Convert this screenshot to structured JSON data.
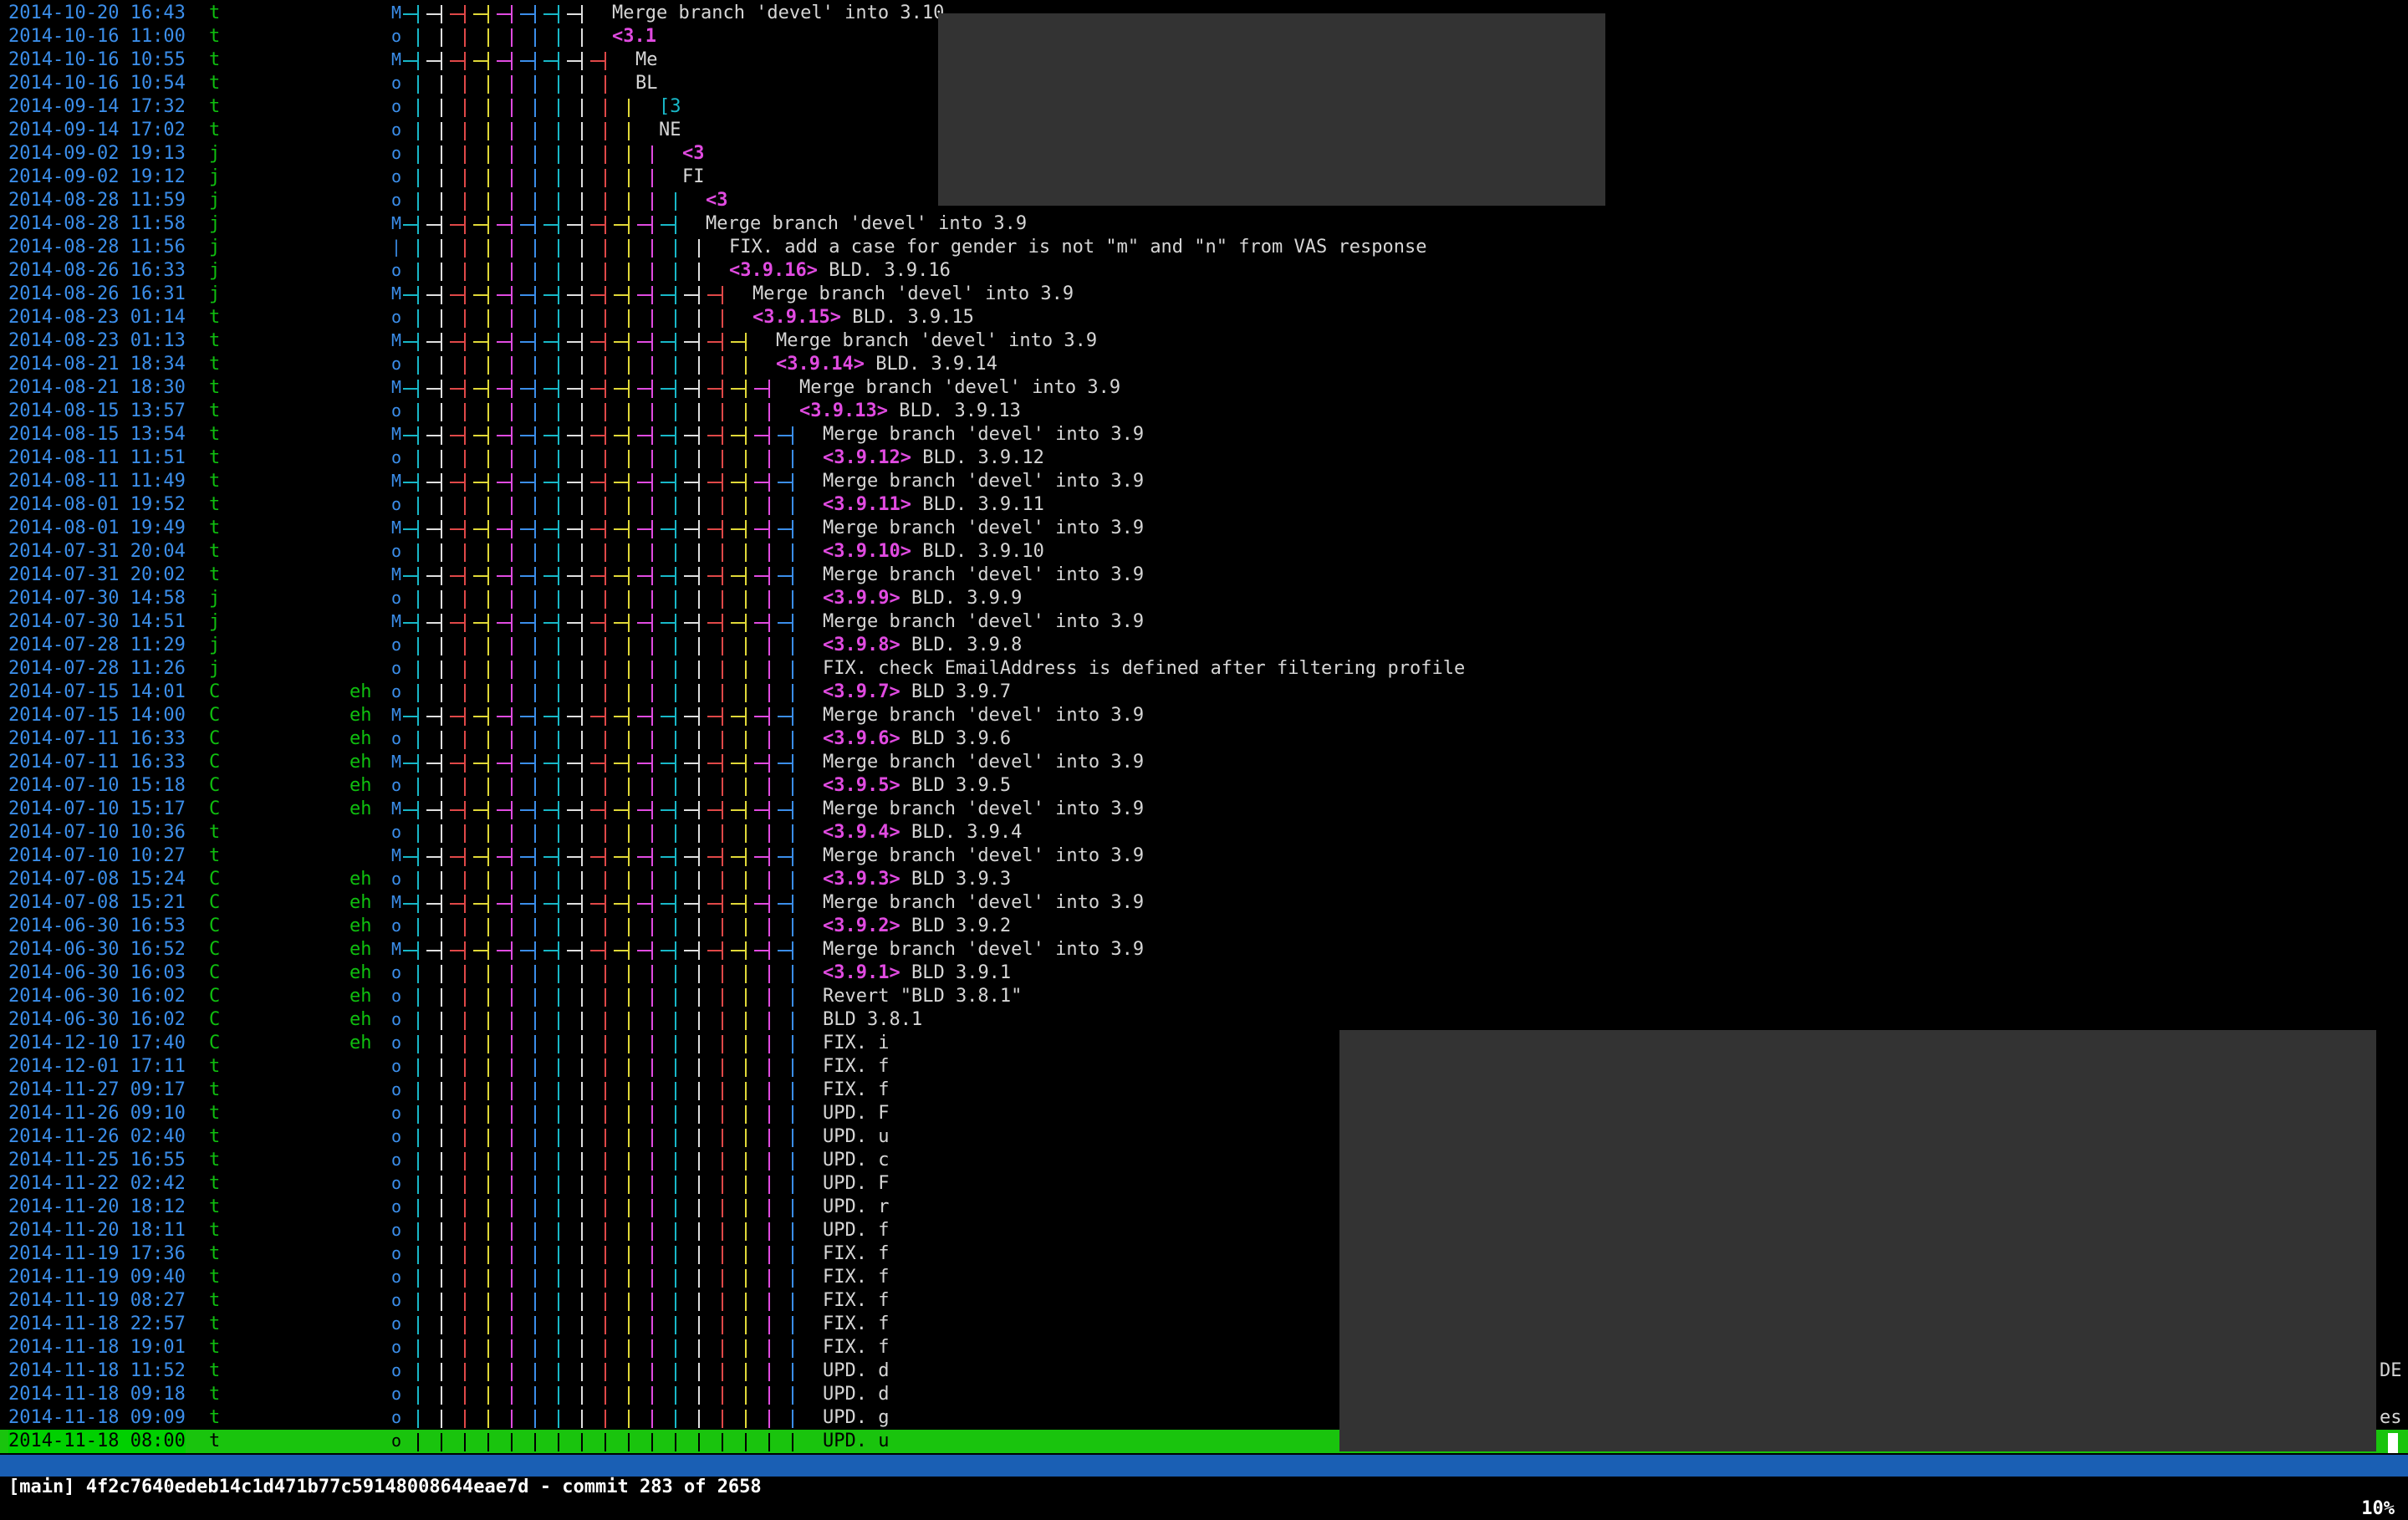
{
  "colors": {
    "date": "#3b8eea",
    "selection": "#19c40d",
    "status_bar": "#1a5fb4",
    "tag": "#e14be1",
    "occluder": "#333333"
  },
  "commits": [
    {
      "date": "2014-10-20 16:43",
      "author": "t",
      "author_tail": "",
      "graph": "M",
      "msg": "Merge branch 'devel' into 3.10",
      "tag": ""
    },
    {
      "date": "2014-10-16 11:00",
      "author": "t",
      "author_tail": "",
      "graph": "o",
      "msg": "",
      "tag": "<3.1"
    },
    {
      "date": "2014-10-16 10:55",
      "author": "t",
      "author_tail": "",
      "graph": "M",
      "msg": "Me",
      "tag": ""
    },
    {
      "date": "2014-10-16 10:54",
      "author": "t",
      "author_tail": "",
      "graph": "o",
      "msg": "BL",
      "tag": ""
    },
    {
      "date": "2014-09-14 17:32",
      "author": "t",
      "author_tail": "",
      "graph": "o",
      "msg": "",
      "tag": "[3"
    },
    {
      "date": "2014-09-14 17:02",
      "author": "t",
      "author_tail": "",
      "graph": "o",
      "msg": "NE",
      "tag": ""
    },
    {
      "date": "2014-09-02 19:13",
      "author": "j",
      "author_tail": "",
      "graph": "o",
      "msg": "",
      "tag": "<3"
    },
    {
      "date": "2014-09-02 19:12",
      "author": "j",
      "author_tail": "",
      "graph": "o",
      "msg": "FI",
      "tag": ""
    },
    {
      "date": "2014-08-28 11:59",
      "author": "j",
      "author_tail": "",
      "graph": "o",
      "msg": "",
      "tag": "<3"
    },
    {
      "date": "2014-08-28 11:58",
      "author": "j",
      "author_tail": "",
      "graph": "M",
      "msg": "Merge branch 'devel' into 3.9",
      "tag": ""
    },
    {
      "date": "2014-08-28 11:56",
      "author": "j",
      "author_tail": "",
      "graph": "|",
      "msg": "FIX. add a case for gender is not \"m\" and \"n\" from VAS response",
      "tag": ""
    },
    {
      "date": "2014-08-26 16:33",
      "author": "j",
      "author_tail": "",
      "graph": "o",
      "msg": "BLD. 3.9.16",
      "tag": "<3.9.16>"
    },
    {
      "date": "2014-08-26 16:31",
      "author": "j",
      "author_tail": "",
      "graph": "M",
      "msg": "Merge branch 'devel' into 3.9",
      "tag": ""
    },
    {
      "date": "2014-08-23 01:14",
      "author": "t",
      "author_tail": "",
      "graph": "o",
      "msg": "BLD. 3.9.15",
      "tag": "<3.9.15>"
    },
    {
      "date": "2014-08-23 01:13",
      "author": "t",
      "author_tail": "",
      "graph": "M",
      "msg": "Merge branch 'devel' into 3.9",
      "tag": ""
    },
    {
      "date": "2014-08-21 18:34",
      "author": "t",
      "author_tail": "",
      "graph": "o",
      "msg": "BLD. 3.9.14",
      "tag": "<3.9.14>"
    },
    {
      "date": "2014-08-21 18:30",
      "author": "t",
      "author_tail": "",
      "graph": "M",
      "msg": "Merge branch 'devel' into 3.9",
      "tag": ""
    },
    {
      "date": "2014-08-15 13:57",
      "author": "t",
      "author_tail": "",
      "graph": "o",
      "msg": "BLD. 3.9.13",
      "tag": "<3.9.13>"
    },
    {
      "date": "2014-08-15 13:54",
      "author": "t",
      "author_tail": "",
      "graph": "M",
      "msg": "Merge branch 'devel' into 3.9",
      "tag": ""
    },
    {
      "date": "2014-08-11 11:51",
      "author": "t",
      "author_tail": "",
      "graph": "o",
      "msg": "BLD. 3.9.12",
      "tag": "<3.9.12>"
    },
    {
      "date": "2014-08-11 11:49",
      "author": "t",
      "author_tail": "",
      "graph": "M",
      "msg": "Merge branch 'devel' into 3.9",
      "tag": ""
    },
    {
      "date": "2014-08-01 19:52",
      "author": "t",
      "author_tail": "",
      "graph": "o",
      "msg": "BLD. 3.9.11",
      "tag": "<3.9.11>"
    },
    {
      "date": "2014-08-01 19:49",
      "author": "t",
      "author_tail": "",
      "graph": "M",
      "msg": "Merge branch 'devel' into 3.9",
      "tag": ""
    },
    {
      "date": "2014-07-31 20:04",
      "author": "t",
      "author_tail": "",
      "graph": "o",
      "msg": "BLD. 3.9.10",
      "tag": "<3.9.10>"
    },
    {
      "date": "2014-07-31 20:02",
      "author": "t",
      "author_tail": "",
      "graph": "M",
      "msg": "Merge branch 'devel' into 3.9",
      "tag": ""
    },
    {
      "date": "2014-07-30 14:58",
      "author": "j",
      "author_tail": "",
      "graph": "o",
      "msg": "BLD. 3.9.9",
      "tag": "<3.9.9>"
    },
    {
      "date": "2014-07-30 14:51",
      "author": "j",
      "author_tail": "",
      "graph": "M",
      "msg": "Merge branch 'devel' into 3.9",
      "tag": ""
    },
    {
      "date": "2014-07-28 11:29",
      "author": "j",
      "author_tail": "",
      "graph": "o",
      "msg": "BLD. 3.9.8",
      "tag": "<3.9.8>"
    },
    {
      "date": "2014-07-28 11:26",
      "author": "j",
      "author_tail": "",
      "graph": "o",
      "msg": "FIX. check EmailAddress is defined after filtering profile",
      "tag": ""
    },
    {
      "date": "2014-07-15 14:01",
      "author": "C",
      "author_tail": "eh",
      "graph": "o",
      "msg": "BLD 3.9.7",
      "tag": "<3.9.7>"
    },
    {
      "date": "2014-07-15 14:00",
      "author": "C",
      "author_tail": "eh",
      "graph": "M",
      "msg": "Merge branch 'devel' into 3.9",
      "tag": ""
    },
    {
      "date": "2014-07-11 16:33",
      "author": "C",
      "author_tail": "eh",
      "graph": "o",
      "msg": "BLD 3.9.6",
      "tag": "<3.9.6>"
    },
    {
      "date": "2014-07-11 16:33",
      "author": "C",
      "author_tail": "eh",
      "graph": "M",
      "msg": "Merge branch 'devel' into 3.9",
      "tag": ""
    },
    {
      "date": "2014-07-10 15:18",
      "author": "C",
      "author_tail": "eh",
      "graph": "o",
      "msg": "BLD 3.9.5",
      "tag": "<3.9.5>"
    },
    {
      "date": "2014-07-10 15:17",
      "author": "C",
      "author_tail": "eh",
      "graph": "M",
      "msg": "Merge branch 'devel' into 3.9",
      "tag": ""
    },
    {
      "date": "2014-07-10 10:36",
      "author": "t",
      "author_tail": "",
      "graph": "o",
      "msg": "BLD. 3.9.4",
      "tag": "<3.9.4>"
    },
    {
      "date": "2014-07-10 10:27",
      "author": "t",
      "author_tail": "",
      "graph": "M",
      "msg": "Merge branch 'devel' into 3.9",
      "tag": ""
    },
    {
      "date": "2014-07-08 15:24",
      "author": "C",
      "author_tail": "eh",
      "graph": "o",
      "msg": "BLD 3.9.3",
      "tag": "<3.9.3>"
    },
    {
      "date": "2014-07-08 15:21",
      "author": "C",
      "author_tail": "eh",
      "graph": "M",
      "msg": "Merge branch 'devel' into 3.9",
      "tag": ""
    },
    {
      "date": "2014-06-30 16:53",
      "author": "C",
      "author_tail": "eh",
      "graph": "o",
      "msg": "BLD 3.9.2",
      "tag": "<3.9.2>"
    },
    {
      "date": "2014-06-30 16:52",
      "author": "C",
      "author_tail": "eh",
      "graph": "M",
      "msg": "Merge branch 'devel' into 3.9",
      "tag": ""
    },
    {
      "date": "2014-06-30 16:03",
      "author": "C",
      "author_tail": "eh",
      "graph": "o",
      "msg": "BLD 3.9.1",
      "tag": "<3.9.1>"
    },
    {
      "date": "2014-06-30 16:02",
      "author": "C",
      "author_tail": "eh",
      "graph": "o",
      "msg": "Revert \"BLD 3.8.1\"",
      "tag": ""
    },
    {
      "date": "2014-06-30 16:02",
      "author": "C",
      "author_tail": "eh",
      "graph": "o",
      "msg": "BLD 3.8.1",
      "tag": ""
    },
    {
      "date": "2014-12-10 17:40",
      "author": "C",
      "author_tail": "eh",
      "graph": "o",
      "msg": "FIX. i",
      "tag": ""
    },
    {
      "date": "2014-12-01 17:11",
      "author": "t",
      "author_tail": "",
      "graph": "o",
      "msg": "FIX. f",
      "tag": ""
    },
    {
      "date": "2014-11-27 09:17",
      "author": "t",
      "author_tail": "",
      "graph": "o",
      "msg": "FIX. f",
      "tag": ""
    },
    {
      "date": "2014-11-26 09:10",
      "author": "t",
      "author_tail": "",
      "graph": "o",
      "msg": "UPD. F",
      "tag": ""
    },
    {
      "date": "2014-11-26 02:40",
      "author": "t",
      "author_tail": "",
      "graph": "o",
      "msg": "UPD. u",
      "tag": ""
    },
    {
      "date": "2014-11-25 16:55",
      "author": "t",
      "author_tail": "",
      "graph": "o",
      "msg": "UPD. c",
      "tag": ""
    },
    {
      "date": "2014-11-22 02:42",
      "author": "t",
      "author_tail": "",
      "graph": "o",
      "msg": "UPD. F",
      "tag": ""
    },
    {
      "date": "2014-11-20 18:12",
      "author": "t",
      "author_tail": "",
      "graph": "o",
      "msg": "UPD. r",
      "tag": ""
    },
    {
      "date": "2014-11-20 18:11",
      "author": "t",
      "author_tail": "",
      "graph": "o",
      "msg": "UPD. f",
      "tag": ""
    },
    {
      "date": "2014-11-19 17:36",
      "author": "t",
      "author_tail": "",
      "graph": "o",
      "msg": "FIX. f",
      "tag": ""
    },
    {
      "date": "2014-11-19 09:40",
      "author": "t",
      "author_tail": "",
      "graph": "o",
      "msg": "FIX. f",
      "tag": ""
    },
    {
      "date": "2014-11-19 08:27",
      "author": "t",
      "author_tail": "",
      "graph": "o",
      "msg": "FIX. f",
      "tag": ""
    },
    {
      "date": "2014-11-18 22:57",
      "author": "t",
      "author_tail": "",
      "graph": "o",
      "msg": "FIX. f",
      "tag": ""
    },
    {
      "date": "2014-11-18 19:01",
      "author": "t",
      "author_tail": "",
      "graph": "o",
      "msg": "FIX. f",
      "tag": ""
    },
    {
      "date": "2014-11-18 11:52",
      "author": "t",
      "author_tail": "",
      "graph": "o",
      "msg": "UPD. d",
      "tag": "",
      "right": "DE"
    },
    {
      "date": "2014-11-18 09:18",
      "author": "t",
      "author_tail": "",
      "graph": "o",
      "msg": "UPD. d",
      "tag": ""
    },
    {
      "date": "2014-11-18 09:09",
      "author": "t",
      "author_tail": "",
      "graph": "o",
      "msg": "UPD. g",
      "tag": "",
      "right": "es"
    },
    {
      "date": "2014-11-18 08:00",
      "author": "t",
      "author_tail": "",
      "graph": "o",
      "msg": "UPD. u",
      "tag": "",
      "selected": true
    }
  ],
  "status": {
    "left": "[main] 4f2c7640edeb14c1d471b77c59148008644eae7d - commit 283 of 2658",
    "right": "10%"
  }
}
